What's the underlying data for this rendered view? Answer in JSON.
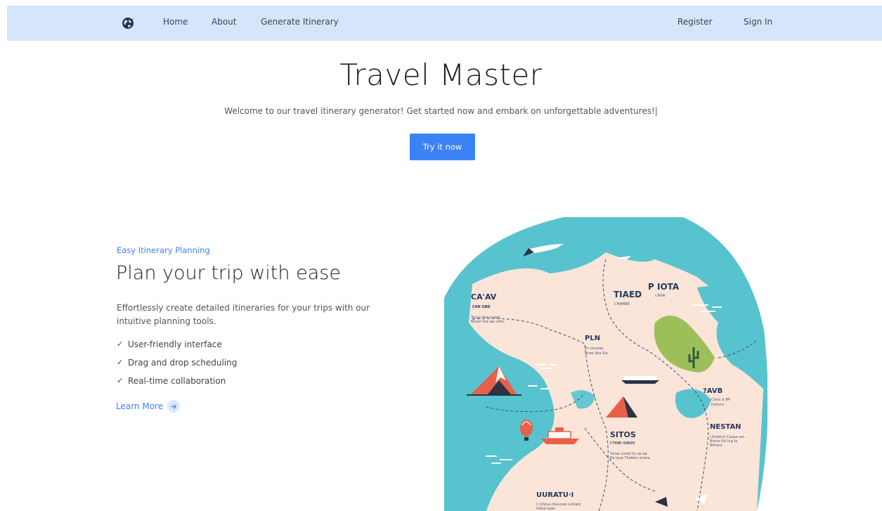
{
  "nav": {
    "logo_icon": "globe-icon",
    "links": [
      "Home",
      "About",
      "Generate Itinerary"
    ],
    "register": "Register",
    "sign_in": "Sign In"
  },
  "hero": {
    "title": "Travel Master",
    "subtitle": "Welcome to our travel itinerary generator! Get started now and embark on unforgettable adventures!|",
    "cta": "Try it now"
  },
  "feature": {
    "eyebrow": "Easy Itinerary Planning",
    "title": "Plan your trip with ease",
    "description": "Effortlessly create detailed itineraries for your trips with our intuitive planning tools.",
    "items": [
      "User-friendly interface",
      "Drag and drop scheduling",
      "Real-time collaboration"
    ],
    "learn_more": "Learn More",
    "learn_more_icon": "arrow-right-icon"
  },
  "map": {
    "labels": [
      "CA'AV",
      "CAN GBD",
      "TIAED",
      "P IOTA",
      "CAVAI",
      "CHNMBE",
      "PLN",
      "?AVB",
      "Clavs & BP",
      "Danvcs",
      "NESTAN",
      "SITOS",
      "I'THBI SIBOV",
      "UURATU·I"
    ],
    "captions": {
      "cav": [
        "Tenes fare taaed",
        "Bheer tire lae utlhs"
      ],
      "pln": [
        "Ps cloveaa",
        "dnee dba Sla"
      ],
      "sitos": [
        "Vinae croed tls ae aa",
        "Ba lpue Thelbes arrera"
      ],
      "nestan": [
        "Lilhalovu Cauae tstl",
        "Brena Ksl Ivg ta",
        "Bltrans"
      ],
      "uuratu": [
        "1 Isfena chaucaw cuhlam",
        "Gtbal kaan"
      ]
    },
    "colors": {
      "water": "#57c3cf",
      "land": "#fbe4d8",
      "forest": "#9dbf5a",
      "accent": "#e8604a",
      "navy": "#243a5e"
    }
  },
  "colors": {
    "navbar_bg": "#d5e5fb",
    "primary": "#3b82f6"
  }
}
